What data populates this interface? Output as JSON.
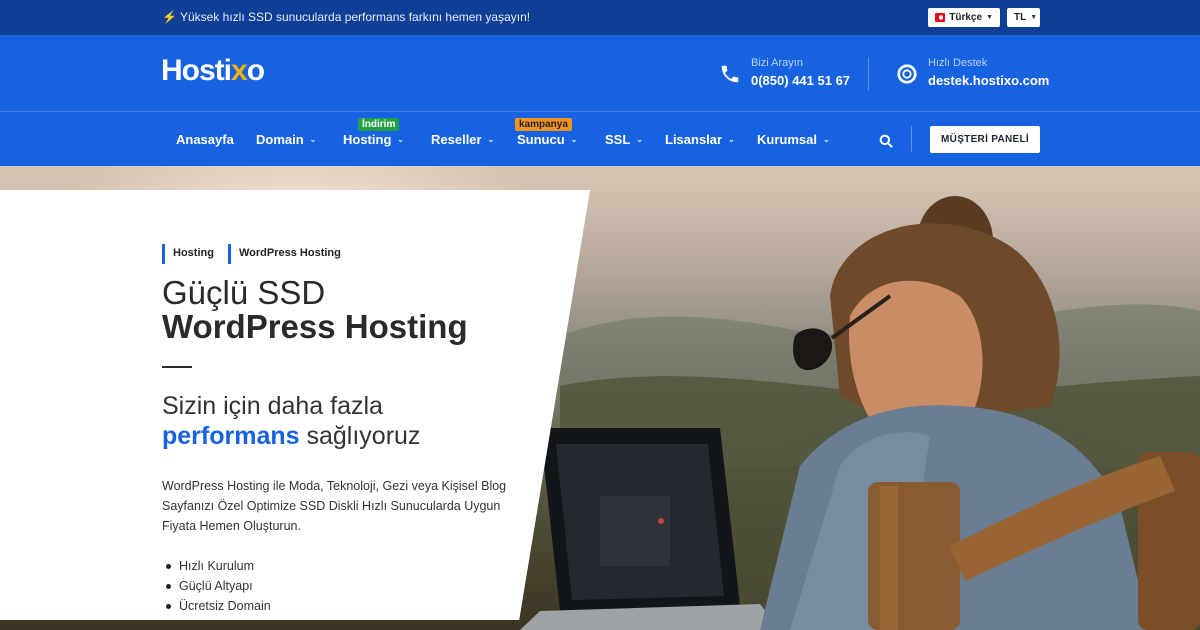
{
  "topbar": {
    "announcement": "Yüksek hızlı SSD sunucularda performans farkını hemen yaşayın!",
    "announcement_icon": "lightning-icon",
    "language": "Türkçe",
    "currency": "TL"
  },
  "header": {
    "logo_text_a": "Hosti",
    "logo_text_b": "x",
    "logo_text_c": "o",
    "phone_label": "Bizi Arayın",
    "phone_value": "0(850) 441 51 67",
    "support_label": "Hızlı Destek",
    "support_value": "destek.hostixo.com"
  },
  "nav": {
    "items": [
      {
        "label": "Anasayfa",
        "has_dropdown": false
      },
      {
        "label": "Domain",
        "has_dropdown": true
      },
      {
        "label": "Hosting",
        "has_dropdown": true,
        "badge": "İndirim"
      },
      {
        "label": "Reseller",
        "has_dropdown": true
      },
      {
        "label": "Sunucu",
        "has_dropdown": true,
        "badge": "kampanya"
      },
      {
        "label": "SSL",
        "has_dropdown": true
      },
      {
        "label": "Lisanslar",
        "has_dropdown": true
      },
      {
        "label": "Kurumsal",
        "has_dropdown": true
      }
    ],
    "panel_button": "MÜŞTERİ PANELİ"
  },
  "hero": {
    "tags": [
      "Hosting",
      "WordPress Hosting"
    ],
    "title_line1": "Güçlü SSD",
    "title_line2": "WordPress Hosting",
    "subtitle_line1": "Sizin için daha fazla",
    "subtitle_highlight": "performans",
    "subtitle_rest": " sağlıyoruz",
    "description": "WordPress Hosting ile Moda, Teknoloji, Gezi veya Kişisel Blog Sayfanızı Özel Optimize SSD Diskli Hızlı Sunucularda Uygun Fiyata Hemen Oluşturun.",
    "features": [
      "Hızlı Kurulum",
      "Güçlü Altyapı",
      "Ücretsiz Domain"
    ]
  },
  "colors": {
    "brand_blue": "#1762e0",
    "topbar_blue": "#0f3f96",
    "logo_accent": "#f5b301",
    "badge_green": "#23a047",
    "badge_orange": "#f29423"
  }
}
